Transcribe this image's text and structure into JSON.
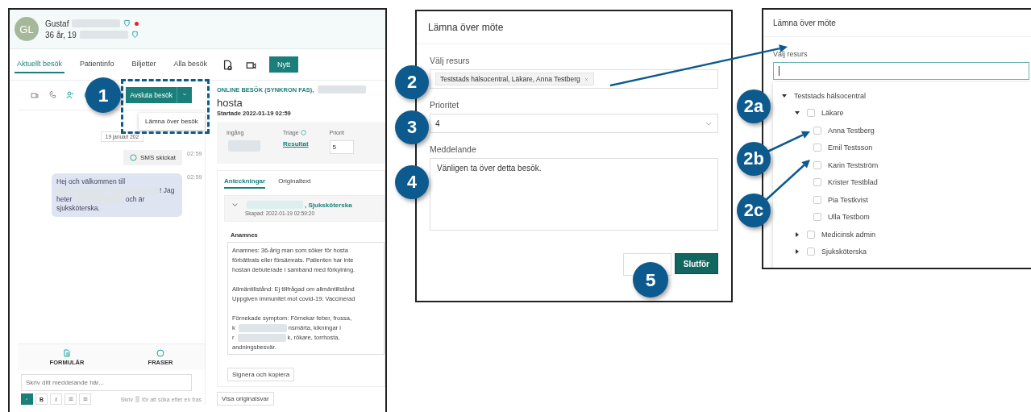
{
  "patient_view": {
    "avatar": "GL",
    "name": "Gustaf",
    "age": "36 år, 19",
    "tabs": [
      {
        "label": "Aktuellt besök",
        "selected": true
      },
      {
        "label": "Patientinfo",
        "selected": false
      },
      {
        "label": "Biljetter",
        "selected": false
      },
      {
        "label": "Alla besök",
        "selected": false
      }
    ],
    "new_button": "Nytt",
    "end_visit_button": "Avsluta besök",
    "menu_items": [
      "Lämna över besök"
    ],
    "chat": {
      "date": "19 januari 202",
      "messages": [
        {
          "kind": "system",
          "text": "SMS skickat",
          "time": "02:59"
        },
        {
          "kind": "message",
          "time": "02:59",
          "parts": [
            {
              "kind": "text",
              "text": "Hej och välkommen till"
            },
            {
              "kind": "redacted"
            },
            {
              "kind": "redacted"
            },
            {
              "kind": "text",
              "text": "! Jag heter"
            },
            {
              "kind": "redacted"
            },
            {
              "kind": "text",
              "text": "och är sjuksköterska."
            }
          ]
        }
      ],
      "tools": [
        "FORMULÄR",
        "FRASER"
      ],
      "composer_placeholder": "Skriv ditt meddelande här...",
      "format_buttons": [
        "B",
        "I"
      ],
      "hint_before": "Skriv",
      "hint_after": "för att söka efter en fras"
    },
    "visit": {
      "type_label": "ONLINE BESÖK (SYNKRON FAS),",
      "title": "hosta",
      "started": "Startade 2022-01-19 02:59",
      "entry_label": "Ingång",
      "triage_label": "Triage",
      "triage_link": "Resultat",
      "priority_label": "Priorit",
      "priority_value": "5",
      "note_tabs": [
        {
          "label": "Anteckningar",
          "selected": true
        },
        {
          "label": "Originaltext",
          "selected": false
        }
      ],
      "note": {
        "author_role": ", Sjuksköterska",
        "created": "Skapad: 2022-01-19 02:59:20",
        "section": "Anamnes",
        "paragraphs": [
          [
            [
              {
                "kind": "text",
                "text": "Anamnes: 36-årig man som söker för hosta"
              }
            ],
            [
              {
                "kind": "text",
                "text": "förbättrats eller försämrats. Patienten har inte"
              }
            ],
            [
              {
                "kind": "text",
                "text": "hostan debuterade i samband med förkylning."
              }
            ]
          ],
          [
            [
              {
                "kind": "text",
                "text": "Allmäntillstånd: Ej tillfrågad om allmäntillstånd"
              }
            ],
            [
              {
                "kind": "text",
                "text": "Uppgiven immunitet mot covid-19: Vaccinerad"
              }
            ]
          ],
          [
            [
              {
                "kind": "text",
                "text": "Förnekade symptom: Förnekar feber, frossa,"
              }
            ],
            [
              {
                "kind": "text",
                "text": "k"
              },
              {
                "kind": "redacted"
              },
              {
                "kind": "text",
                "text": "nsmärta, kikningar i"
              }
            ],
            [
              {
                "kind": "text",
                "text": "r"
              },
              {
                "kind": "redacted"
              },
              {
                "kind": "text",
                "text": "k, rökare, torrhosta,"
              }
            ],
            [
              {
                "kind": "text",
                "text": "andningsbesvär."
              }
            ]
          ]
        ],
        "sign_button": "Signera och kopiera"
      },
      "original_button": "Visa originalsvar"
    }
  },
  "handover_dialog": {
    "title": "Lämna över möte",
    "resource_label": "Välj resurs",
    "resource_chip": "Teststads hälsocentral, Läkare, Anna Testberg",
    "priority_label": "Prioritet",
    "priority_value": "4",
    "message_label": "Meddelande",
    "message_value": "Vänligen ta över detta besök.",
    "finish_button": "Slutför"
  },
  "resource_picker": {
    "title": "Lämna över möte",
    "resource_label": "Välj resurs",
    "tree": {
      "label": "Teststads hälsocentral",
      "expanded": true,
      "children": [
        {
          "label": "Läkare",
          "expanded": true,
          "checked": false,
          "children": [
            {
              "label": "Anna Testberg",
              "checked": false
            },
            {
              "label": "Emil Testsson",
              "checked": false
            },
            {
              "label": "Karin Testström",
              "checked": false
            },
            {
              "label": "Krister Testblad",
              "checked": false
            },
            {
              "label": "Pia Testkvist",
              "checked": false
            },
            {
              "label": "Ulla Testbom",
              "checked": false
            }
          ]
        },
        {
          "label": "Medicinsk admin",
          "expanded": false,
          "checked": false
        },
        {
          "label": "Sjuksköterska",
          "expanded": false,
          "checked": false
        }
      ]
    }
  },
  "callouts": [
    "1",
    "2",
    "3",
    "4",
    "5",
    "2a",
    "2b",
    "2c"
  ]
}
